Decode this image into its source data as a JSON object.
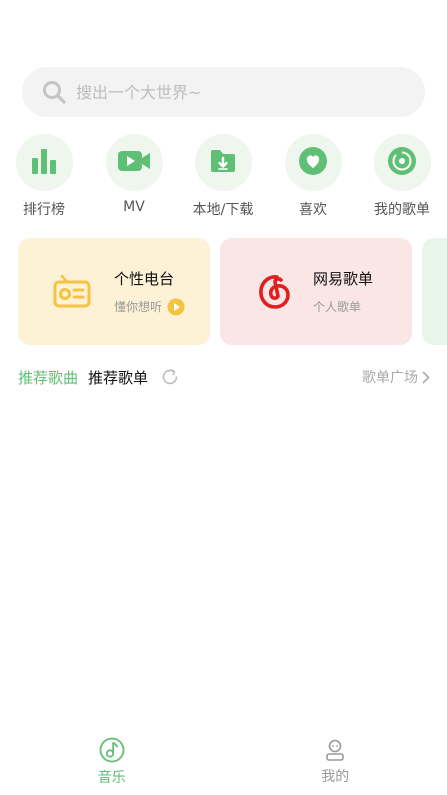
{
  "search": {
    "placeholder": "搜出一个大世界~"
  },
  "nav": [
    {
      "label": "排行榜",
      "icon": "bar-chart-icon"
    },
    {
      "label": "MV",
      "icon": "video-icon"
    },
    {
      "label": "本地/下载",
      "icon": "download-folder-icon"
    },
    {
      "label": "喜欢",
      "icon": "heart-icon"
    },
    {
      "label": "我的歌单",
      "icon": "disc-icon"
    }
  ],
  "cards": [
    {
      "title": "个性电台",
      "subtitle": "懂你想听",
      "icon": "radio-icon",
      "bg": "#fdf1d6",
      "accent": "#f5c242"
    },
    {
      "title": "网易歌单",
      "subtitle": "个人歌单",
      "icon": "netease-icon",
      "bg": "#fbe6e6",
      "accent": "#e02020"
    }
  ],
  "section": {
    "tab_recommend_songs": "推荐歌曲",
    "tab_recommend_playlists": "推荐歌单",
    "more": "歌单广场"
  },
  "bottom_nav": [
    {
      "label": "音乐",
      "icon": "music-note-icon",
      "active": true
    },
    {
      "label": "我的",
      "icon": "user-icon",
      "active": false
    }
  ],
  "colors": {
    "accent": "#5fbf74",
    "nav_bg": "#eef6ee",
    "inactive": "#999999"
  }
}
